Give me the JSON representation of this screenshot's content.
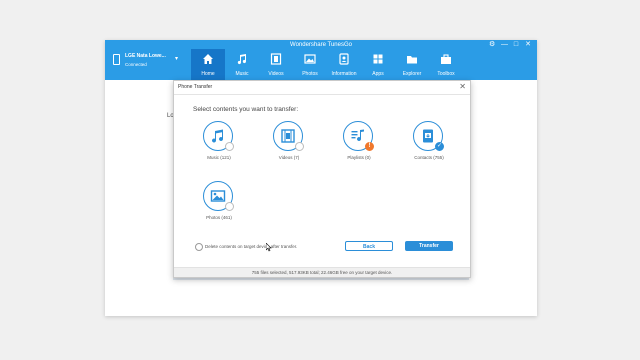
{
  "app": {
    "title": "Wondershare TunesGo",
    "window_controls": [
      "⚙",
      "—",
      "□",
      "✕"
    ]
  },
  "device": {
    "name": "LGE Nata Lowe...",
    "status": "Connected"
  },
  "nav": {
    "items": [
      {
        "label": "Home",
        "icon": "home-icon"
      },
      {
        "label": "Music",
        "icon": "music-icon"
      },
      {
        "label": "Videos",
        "icon": "video-icon"
      },
      {
        "label": "Photos",
        "icon": "photo-icon"
      },
      {
        "label": "Information",
        "icon": "contacts-icon"
      },
      {
        "label": "Apps",
        "icon": "apps-icon"
      },
      {
        "label": "Explorer",
        "icon": "folder-icon"
      },
      {
        "label": "Toolbox",
        "icon": "toolbox-icon"
      }
    ]
  },
  "background_text": "Lo",
  "dialog": {
    "title": "Phone Transfer",
    "close_glyph": "✕",
    "prompt": "Select contents you want to transfer:",
    "items": [
      {
        "label": "Music (121)",
        "icon": "music-note-icon",
        "state": "unchecked"
      },
      {
        "label": "Videos (7)",
        "icon": "film-icon",
        "state": "unchecked"
      },
      {
        "label": "Playlists (0)",
        "icon": "playlist-icon",
        "state": "warning"
      },
      {
        "label": "Contacts (755)",
        "icon": "contacts-book-icon",
        "state": "checked"
      },
      {
        "label": "Photos (461)",
        "icon": "picture-icon",
        "state": "unchecked"
      }
    ],
    "delete_option": "Delete contents on target device after transfer.",
    "back_label": "Back",
    "transfer_label": "Transfer",
    "status": "755 files selected, 517.93KB total; 22.46GB free on your target device."
  },
  "colors": {
    "accent": "#2b8ed8",
    "titlebar": "#2b9ce6",
    "nav_active": "#1676c8",
    "warning": "#f0782d"
  }
}
